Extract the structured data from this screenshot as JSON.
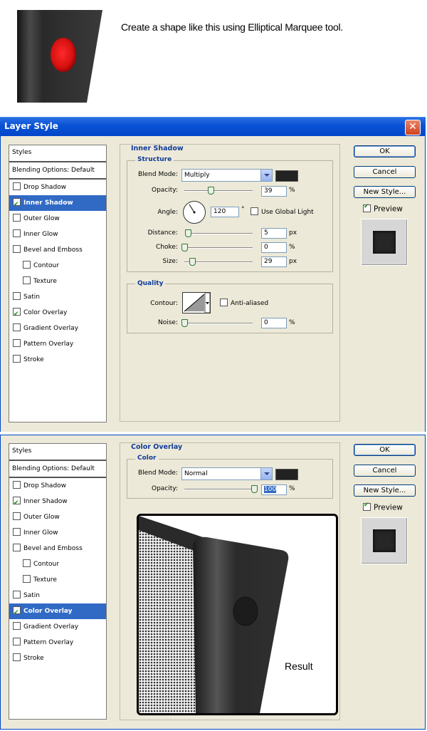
{
  "intro": {
    "caption": "Create a shape like this using Elliptical Marquee tool."
  },
  "dialog": {
    "title": "Layer Style",
    "close_glyph": "✕"
  },
  "style_list": {
    "header": "Styles",
    "blending": "Blending Options: Default",
    "items": [
      {
        "label": "Drop Shadow",
        "checked": false,
        "indent": false
      },
      {
        "label": "Inner Shadow",
        "checked": true,
        "indent": false
      },
      {
        "label": "Outer Glow",
        "checked": false,
        "indent": false
      },
      {
        "label": "Inner Glow",
        "checked": false,
        "indent": false
      },
      {
        "label": "Bevel and Emboss",
        "checked": false,
        "indent": false
      },
      {
        "label": "Contour",
        "checked": false,
        "indent": true
      },
      {
        "label": "Texture",
        "checked": false,
        "indent": true
      },
      {
        "label": "Satin",
        "checked": false,
        "indent": false
      },
      {
        "label": "Color Overlay",
        "checked": true,
        "indent": false
      },
      {
        "label": "Gradient Overlay",
        "checked": false,
        "indent": false
      },
      {
        "label": "Pattern Overlay",
        "checked": false,
        "indent": false
      },
      {
        "label": "Stroke",
        "checked": false,
        "indent": false
      }
    ]
  },
  "buttons": {
    "ok": "OK",
    "cancel": "Cancel",
    "new_style": "New Style...",
    "preview": "Preview"
  },
  "inner_shadow": {
    "title": "Inner Shadow",
    "structure": "Structure",
    "blend_mode_label": "Blend Mode:",
    "blend_mode": "Multiply",
    "color": "#222222",
    "opacity_label": "Opacity:",
    "opacity": "39",
    "opacity_fraction": 0.39,
    "angle_label": "Angle:",
    "angle": "120",
    "angle_unit": "°",
    "global_light": "Use Global Light",
    "distance_label": "Distance:",
    "distance": "5",
    "distance_fraction": 0.02,
    "choke_label": "Choke:",
    "choke": "0",
    "choke_fraction": 0.0,
    "size_label": "Size:",
    "size": "29",
    "size_fraction": 0.115,
    "pct": "%",
    "px": "px",
    "quality": "Quality",
    "contour_label": "Contour:",
    "anti_aliased": "Anti-aliased",
    "noise_label": "Noise:",
    "noise": "0",
    "noise_fraction": 0.0
  },
  "color_overlay": {
    "title": "Color Overlay",
    "group": "Color",
    "blend_mode_label": "Blend Mode:",
    "blend_mode": "Normal",
    "color": "#222222",
    "opacity_label": "Opacity:",
    "opacity": "100",
    "opacity_fraction": 1.0,
    "pct": "%",
    "result_label": "Result"
  }
}
